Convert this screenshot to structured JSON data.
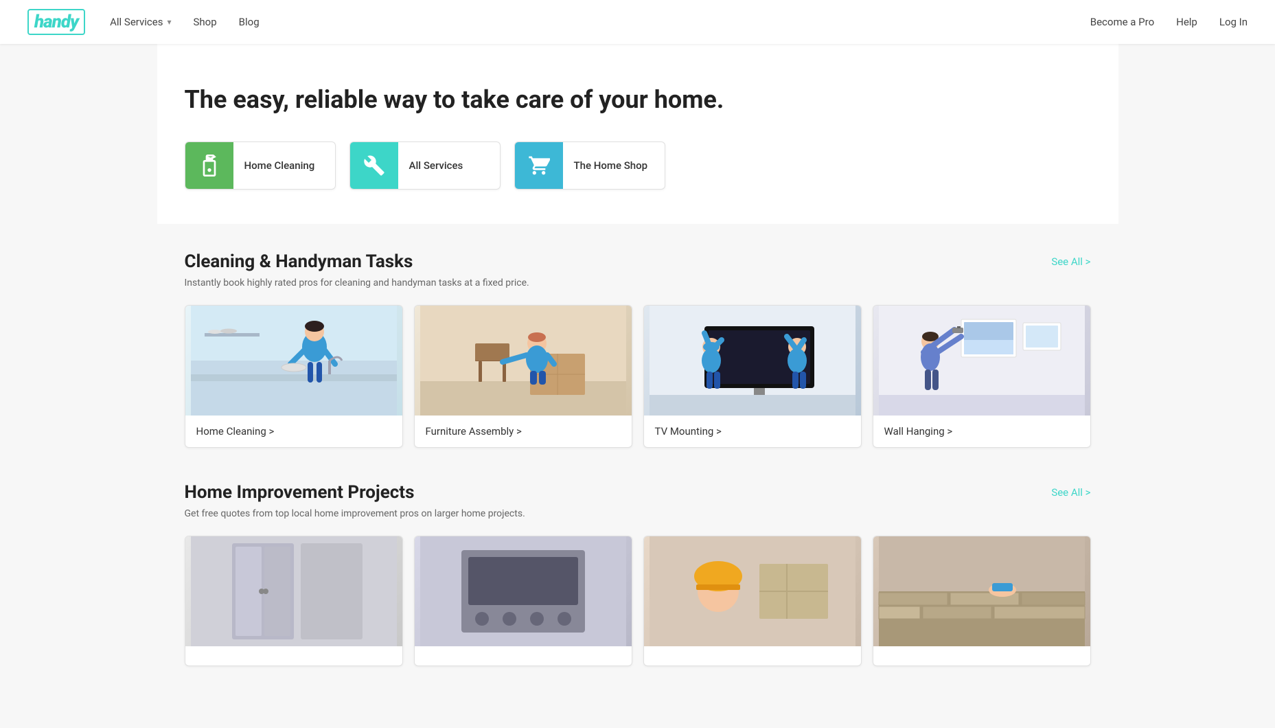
{
  "logo": {
    "text": "handy"
  },
  "nav": {
    "left": [
      {
        "label": "All Services",
        "has_dropdown": true
      },
      {
        "label": "Shop",
        "has_dropdown": false
      },
      {
        "label": "Blog",
        "has_dropdown": false
      }
    ],
    "right": [
      {
        "label": "Become a Pro"
      },
      {
        "label": "Help"
      },
      {
        "label": "Log In"
      }
    ]
  },
  "hero": {
    "headline": "The easy, reliable way to take care of your home."
  },
  "category_cards": [
    {
      "id": "home-cleaning",
      "label": "Home Cleaning",
      "icon_type": "cleaning",
      "color_class": "icon-green"
    },
    {
      "id": "all-services",
      "label": "All Services",
      "icon_type": "wrench",
      "color_class": "icon-teal"
    },
    {
      "id": "the-home-shop",
      "label": "The Home Shop",
      "icon_type": "cart",
      "color_class": "icon-blue"
    }
  ],
  "cleaning_section": {
    "title": "Cleaning & Handyman Tasks",
    "subtitle": "Instantly book highly rated pros for cleaning and handyman tasks at a fixed price.",
    "see_all_label": "See All >",
    "cards": [
      {
        "id": "home-cleaning-card",
        "label": "Home Cleaning >"
      },
      {
        "id": "furniture-assembly-card",
        "label": "Furniture Assembly >"
      },
      {
        "id": "tv-mounting-card",
        "label": "TV Mounting >"
      },
      {
        "id": "wall-hanging-card",
        "label": "Wall Hanging >"
      }
    ]
  },
  "improvement_section": {
    "title": "Home Improvement Projects",
    "subtitle": "Get free quotes from top local home improvement pros on larger home projects.",
    "see_all_label": "See All >",
    "cards": [
      {
        "id": "improvement-1",
        "label": ""
      },
      {
        "id": "improvement-2",
        "label": ""
      },
      {
        "id": "improvement-3",
        "label": ""
      },
      {
        "id": "improvement-4",
        "label": ""
      }
    ]
  }
}
